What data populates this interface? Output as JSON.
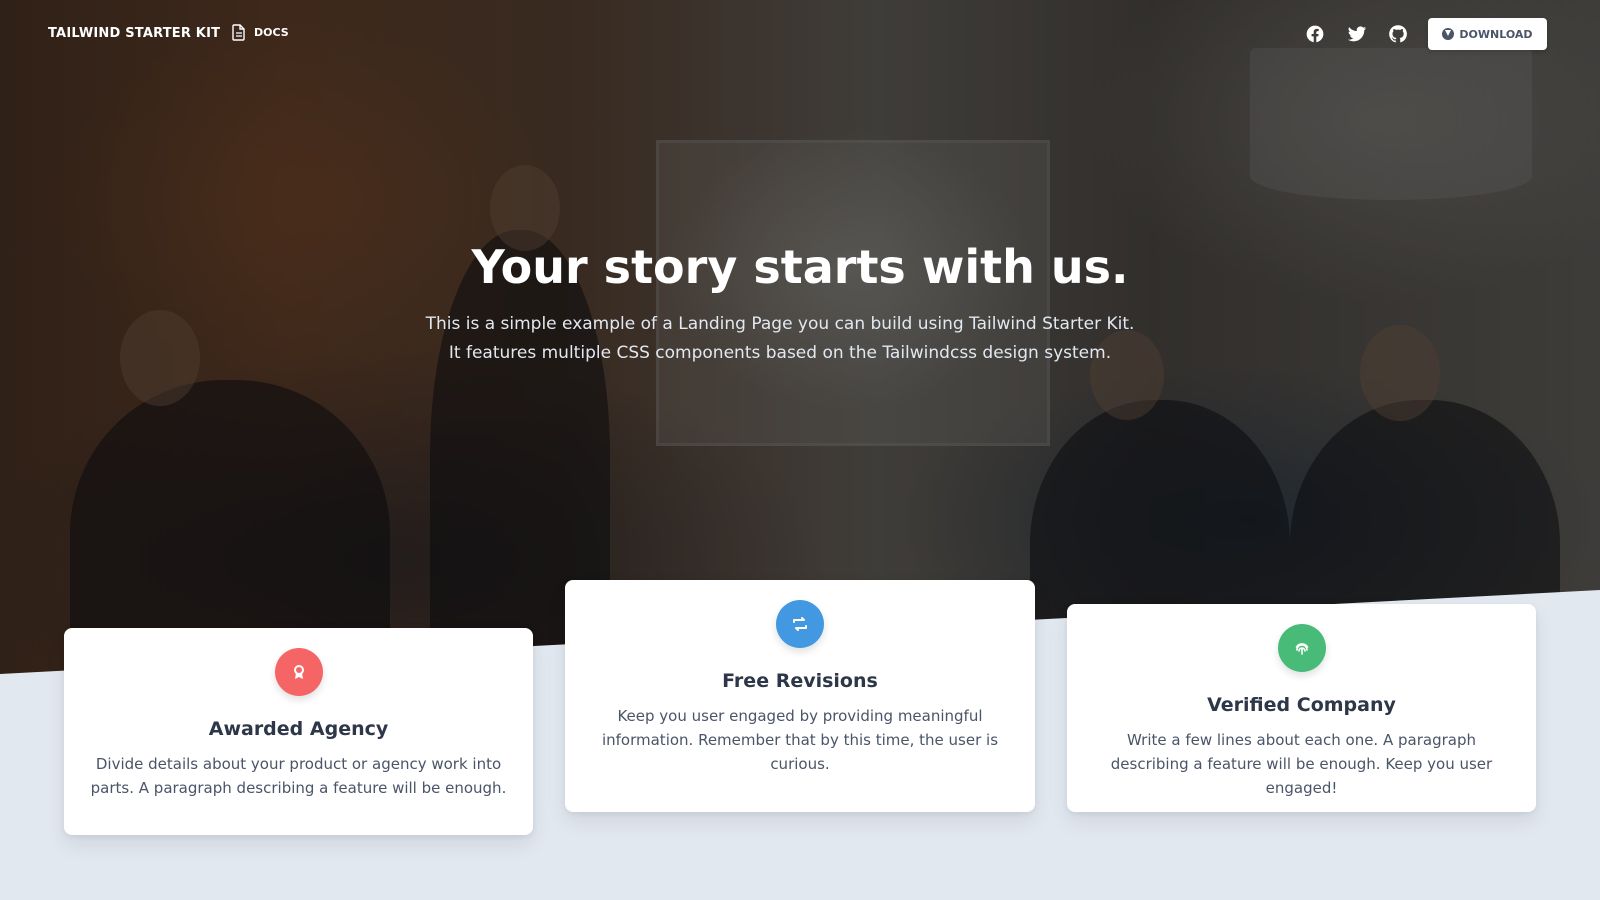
{
  "nav": {
    "brand": "TAILWIND STARTER KIT",
    "docs_label": "DOCS",
    "social": [
      "facebook-icon",
      "twitter-icon",
      "github-icon"
    ],
    "download_label": "DOWNLOAD"
  },
  "hero": {
    "title": "Your story starts with us.",
    "subtitle": "This is a simple example of a Landing Page you can build using Tailwind Starter Kit. It features multiple CSS components based on the Tailwindcss design system."
  },
  "cards": [
    {
      "icon": "award-icon",
      "icon_color": "#f56565",
      "title": "Awarded Agency",
      "text": "Divide details about your product or agency work into parts. A paragraph describing a feature will be enough."
    },
    {
      "icon": "retweet-icon",
      "icon_color": "#4299e1",
      "title": "Free Revisions",
      "text": "Keep you user engaged by providing meaningful information. Remember that by this time, the user is curious."
    },
    {
      "icon": "fingerprint-icon",
      "icon_color": "#48bb78",
      "title": "Verified Company",
      "text": "Write a few lines about each one. A paragraph describing a feature will be enough. Keep you user engaged!"
    }
  ],
  "colors": {
    "page_bg": "#e2e8f0",
    "card_bg": "#ffffff",
    "heading": "#2d3748",
    "body_text": "#4a5568"
  }
}
